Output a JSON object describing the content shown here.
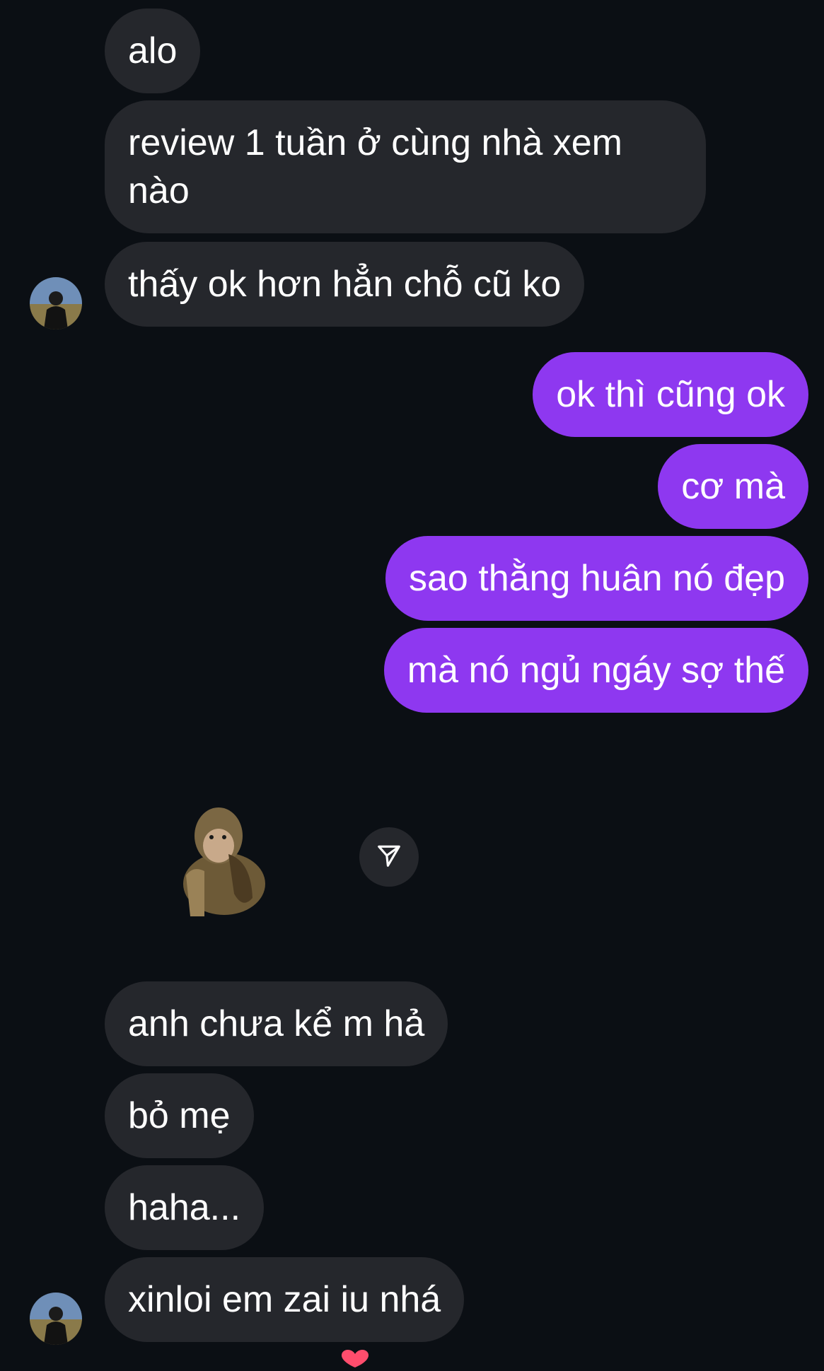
{
  "colors": {
    "background": "#0b0f14",
    "incoming_bubble": "#25272c",
    "outgoing_bubble": "#8e38f0",
    "text": "#ffffff"
  },
  "messages_group_1": [
    "alo",
    "review 1 tuần ở cùng nhà xem nào",
    "thấy ok hơn hẳn chỗ cũ ko"
  ],
  "outgoing_messages": [
    "ok thì cũng ok",
    "cơ mà",
    "sao thằng huân nó đẹp",
    "mà nó ngủ ngáy sợ thế"
  ],
  "sticker": {
    "icon": "monkey-sticker"
  },
  "share_button": {
    "icon": "send-icon"
  },
  "messages_group_2": [
    "anh chưa kể m hả",
    "bỏ mẹ",
    "haha...",
    "xinloi em zai iu nhá"
  ],
  "reaction": {
    "icon": "heart-icon"
  }
}
